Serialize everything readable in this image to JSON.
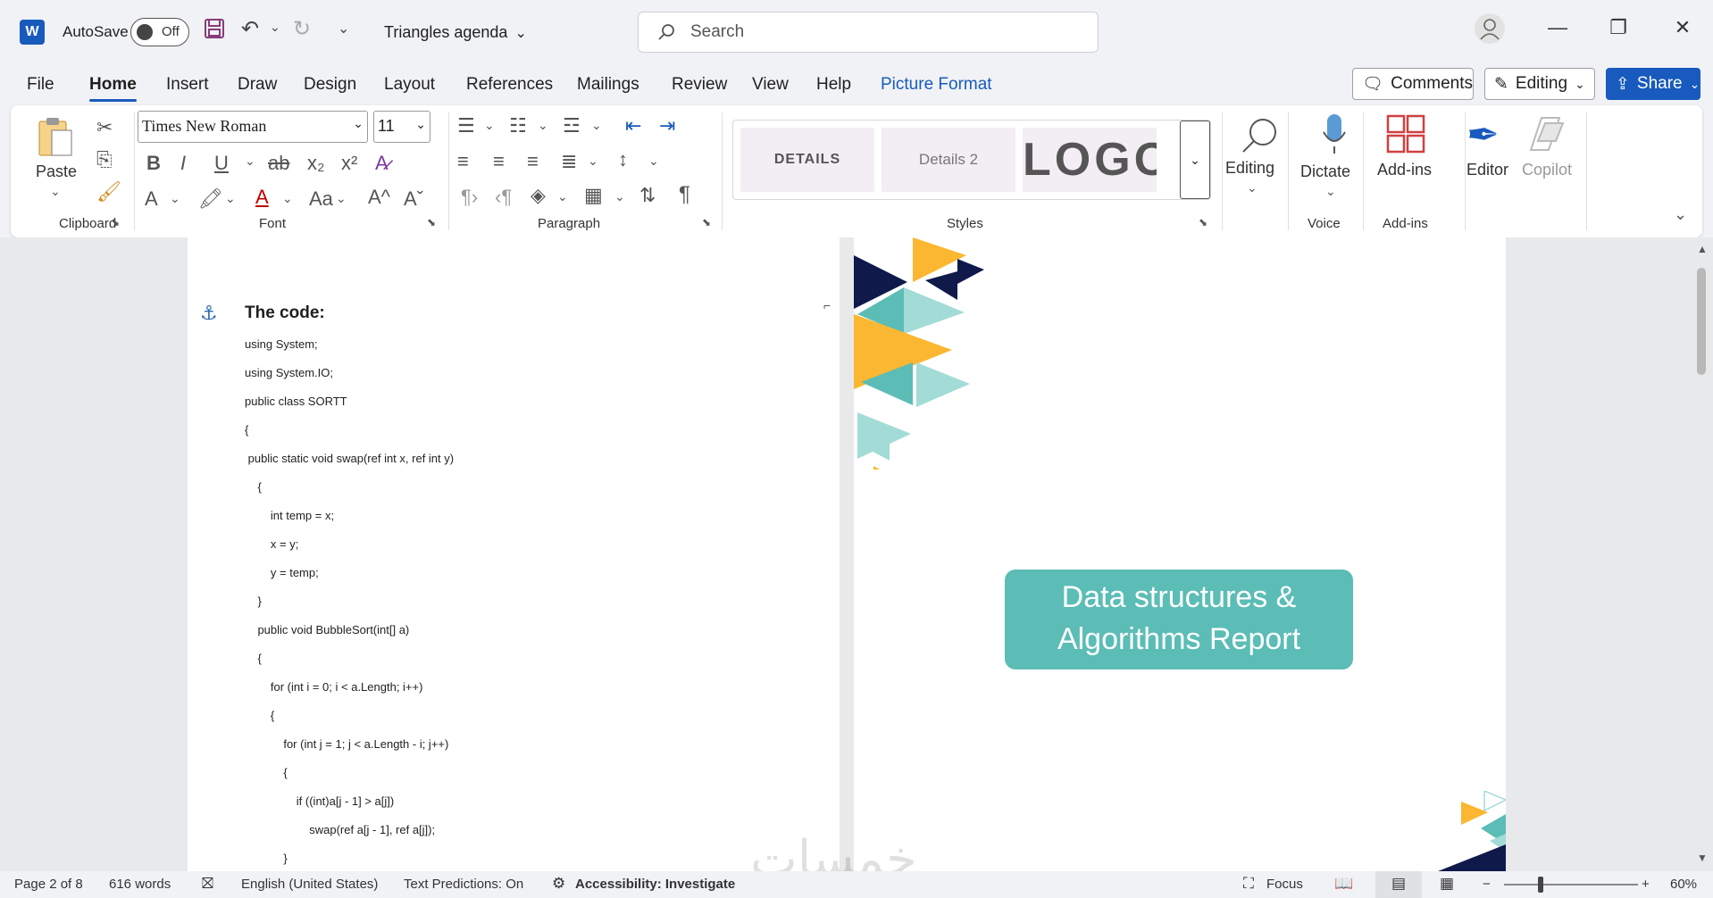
{
  "titlebar": {
    "app_icon": "W",
    "autosave_label": "AutoSave",
    "autosave_state": "Off",
    "doc_title": "Triangles agenda",
    "search_placeholder": "Search"
  },
  "menu": {
    "items": [
      "File",
      "Home",
      "Insert",
      "Draw",
      "Design",
      "Layout",
      "References",
      "Mailings",
      "Review",
      "View",
      "Help",
      "Picture Format"
    ],
    "active": "Home"
  },
  "header_buttons": {
    "comments": "Comments",
    "editing": "Editing",
    "share": "Share"
  },
  "ribbon": {
    "clipboard": {
      "paste": "Paste",
      "label": "Clipboard"
    },
    "font": {
      "family": "Times New Roman",
      "size": "11",
      "label": "Font"
    },
    "paragraph": {
      "label": "Paragraph"
    },
    "styles": {
      "tiles": [
        "DETAILS",
        "Details 2",
        "LOGO"
      ],
      "label": "Styles"
    },
    "editing": {
      "label": "Editing"
    },
    "voice": {
      "dictate": "Dictate",
      "label": "Voice"
    },
    "addins": {
      "button": "Add-ins",
      "label": "Add-ins"
    },
    "editor": "Editor",
    "copilot": "Copilot"
  },
  "document": {
    "heading": "The code:",
    "code_lines": [
      "using System;",
      "using System.IO;",
      "public class SORTT",
      "{",
      " public static void swap(ref int x, ref int y)",
      "    {",
      "        int temp = x;",
      "        x = y;",
      "        y = temp;",
      "    }",
      "    public void BubbleSort(int[] a)",
      "    {",
      "        for (int i = 0; i < a.Length; i++)",
      "        {",
      "            for (int j = 1; j < a.Length - i; j++)",
      "            {",
      "                if ((int)a[j - 1] > a[j])",
      "                    swap(ref a[j - 1], ref a[j]);",
      "            }"
    ],
    "report_title_1": "Data structures &",
    "report_title_2": "Algorithms Report"
  },
  "statusbar": {
    "page": "Page 2 of 8",
    "words": "616 words",
    "language": "English (United States)",
    "predictions": "Text Predictions: On",
    "accessibility": "Accessibility: Investigate",
    "focus": "Focus",
    "zoom": "60%"
  },
  "watermark": "خمسات",
  "colors": {
    "accent": "#185abd",
    "teal": "#5bbdb6",
    "navy": "#0f1a4a",
    "yellow": "#fbb731",
    "light_teal": "#a3dcd7"
  }
}
